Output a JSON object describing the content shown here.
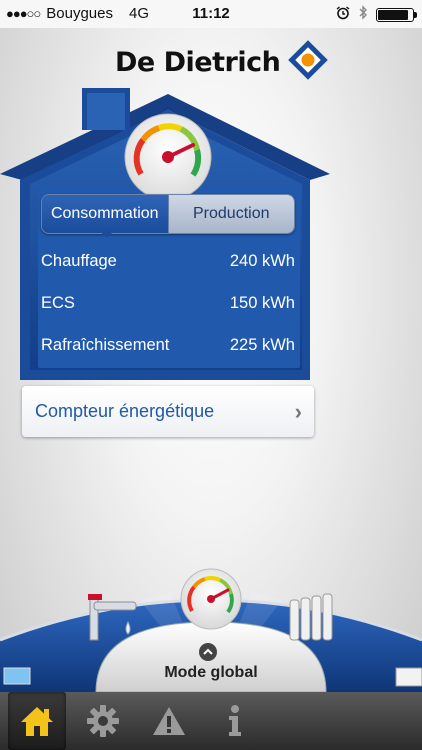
{
  "status_bar": {
    "signal_dots": "●●●○○",
    "carrier": "Bouygues",
    "network": "4G",
    "time": "11:12",
    "battery_level": 0.9
  },
  "brand": {
    "name": "De Dietrich",
    "primary_blue": "#1b4c9c",
    "accent_orange": "#f39200"
  },
  "tabs": [
    {
      "label": "Consommation",
      "active": true
    },
    {
      "label": "Production",
      "active": false
    }
  ],
  "consumption": [
    {
      "label": "Chauffage",
      "value": "240 kWh"
    },
    {
      "label": "ECS",
      "value": "150 kWh"
    },
    {
      "label": "Rafraîchissement",
      "value": "225 kWh"
    }
  ],
  "compteur": {
    "label": "Compteur énergétique",
    "icon": "chevron-right-icon"
  },
  "mode": {
    "label": "Mode global",
    "icon": "chevron-up-icon"
  },
  "tabbar": {
    "items": [
      {
        "icon": "home-icon",
        "active": true
      },
      {
        "icon": "gear-icon",
        "active": false
      },
      {
        "icon": "warning-icon",
        "active": false
      },
      {
        "icon": "info-icon",
        "active": false
      }
    ]
  }
}
